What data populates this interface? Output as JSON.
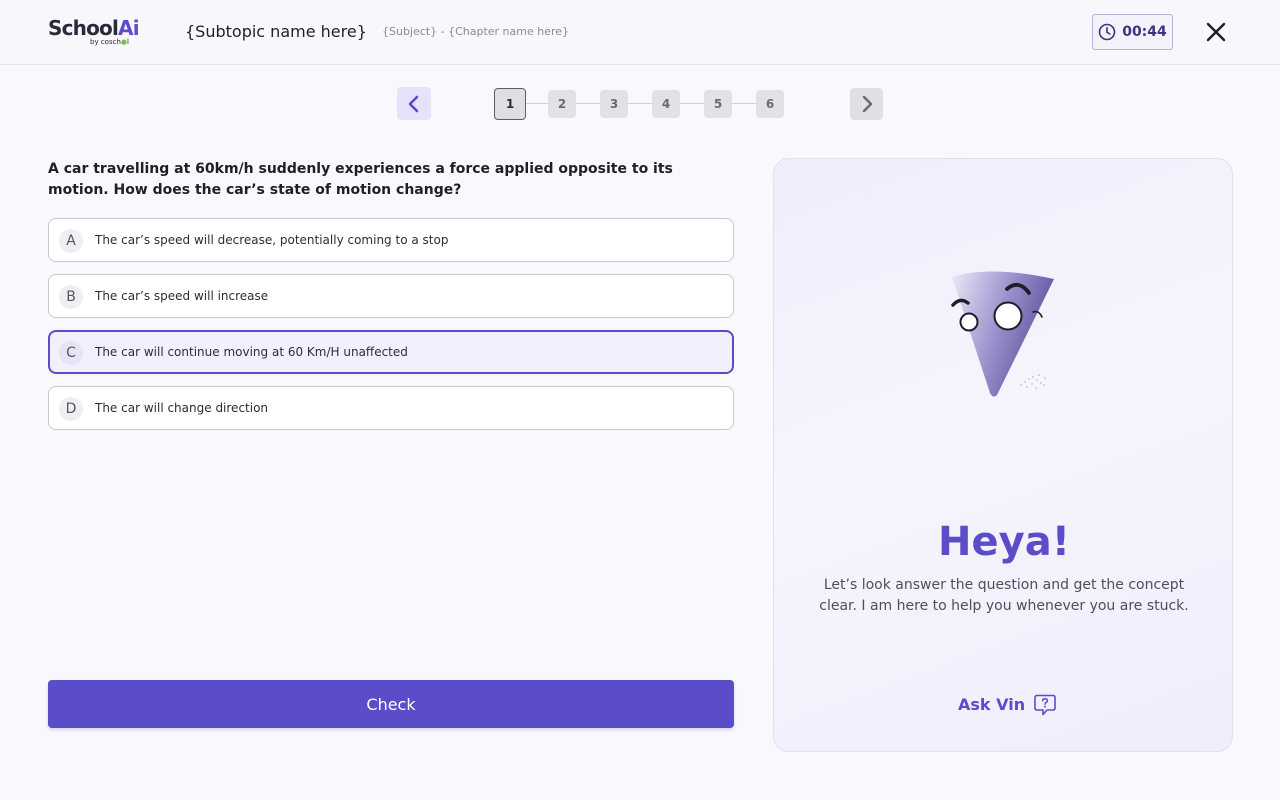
{
  "header": {
    "logo_main_left": "School",
    "logo_main_right": "Ai",
    "logo_sub_left": "by cosch",
    "logo_sub_dot": "●",
    "logo_sub_right": "l",
    "subtopic": "{Subtopic name here}",
    "breadcrumb": "{Subject} - {Chapter name here}",
    "timer": "00:44"
  },
  "pagination": {
    "pages": [
      "1",
      "2",
      "3",
      "4",
      "5",
      "6"
    ],
    "active": "1"
  },
  "question": {
    "text": "A car travelling at 60km/h suddenly experiences a force applied opposite to its motion. How does the car’s state of motion change?",
    "options": [
      {
        "letter": "A",
        "text": "The car’s speed will decrease, potentially coming to a stop"
      },
      {
        "letter": "B",
        "text": "The car’s speed will increase"
      },
      {
        "letter": "C",
        "text": "The car will continue moving at 60 Km/H unaffected"
      },
      {
        "letter": "D",
        "text": "The car will change direction"
      }
    ],
    "selected": "C"
  },
  "check_label": "Check",
  "panel": {
    "heading": "Heya!",
    "message": "Let’s look answer the question and get the concept clear. I am here to help you whenever you are stuck.",
    "ask_label": "Ask Vin"
  },
  "colors": {
    "accent": "#5b4cc9",
    "accent_light": "#e6e2fa",
    "border": "#c8c8d0"
  }
}
